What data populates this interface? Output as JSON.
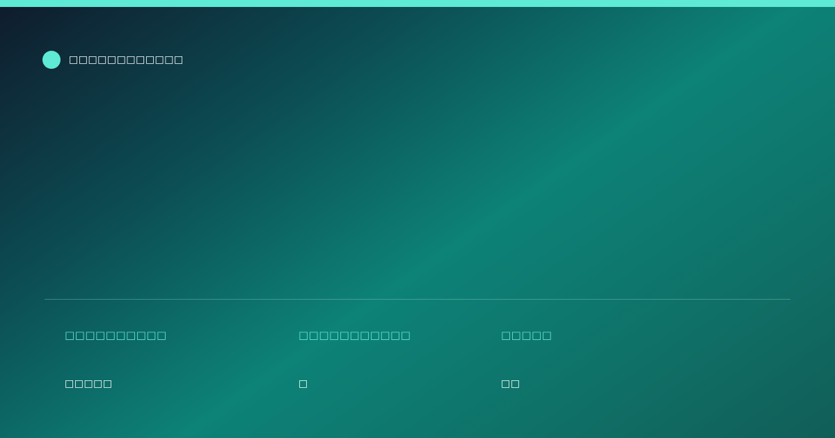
{
  "colors": {
    "accent": "#5eead4",
    "background_start": "#0f1b2c",
    "background_mid": "#0d8277",
    "background_end": "#115e57",
    "text_primary": "#ffffff"
  },
  "brand": {
    "logo_icon": "circle-icon",
    "name": "□□□□□□□□□□□□"
  },
  "stats": [
    {
      "label": "□□□□□□□□□□",
      "value": "□□□□□"
    },
    {
      "label": "□□□□□□□□□□□",
      "value": "□"
    },
    {
      "label": "□□□□□",
      "value": "□□"
    }
  ]
}
